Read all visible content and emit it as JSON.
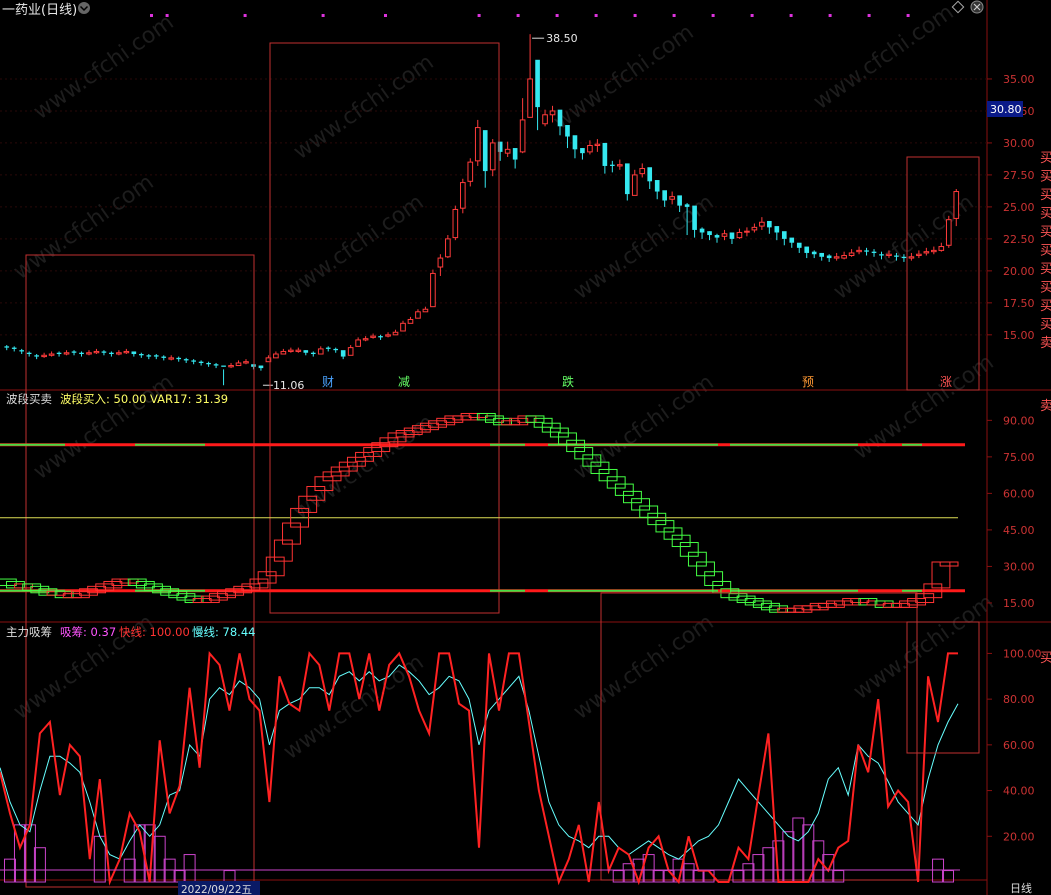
{
  "header": {
    "title": "一药业(日线)",
    "top_right_icons": [
      "diamond-icon",
      "close-icon"
    ],
    "chevron": "chevron-down-icon"
  },
  "price_panel": {
    "current_price_tag": "30.80",
    "high_label": "38.50",
    "low_label": "11.06",
    "signals": [
      {
        "text": "财",
        "color": "#4aa3ff"
      },
      {
        "text": "减",
        "color": "#66ff66"
      },
      {
        "text": "跌",
        "color": "#66ff66"
      },
      {
        "text": "预",
        "color": "#ff9933"
      },
      {
        "text": "涨",
        "color": "#ff5555"
      }
    ],
    "right_edge_labels": [
      "买",
      "买",
      "买",
      "买",
      "买",
      "买",
      "买",
      "买",
      "买",
      "买",
      "卖买"
    ]
  },
  "osc_panel": {
    "name": "波段买卖",
    "legend": [
      {
        "text": "波段买入: 50.00",
        "color": "#ffff66"
      },
      {
        "text": "VAR17: 31.39",
        "color": "#ffff66"
      }
    ],
    "right_edge_label": "卖"
  },
  "flow_panel": {
    "name": "主力吸筹",
    "legend": [
      {
        "text": "吸筹: 0.37",
        "color": "#ff55ff"
      },
      {
        "text": "快线: 100.00",
        "color": "#ff3333"
      },
      {
        "text": "慢线: 78.44",
        "color": "#66ffff"
      }
    ],
    "right_edge_label": "买"
  },
  "x_axis": {
    "labels": [
      "2022/09/22五"
    ],
    "corner_label": "日线"
  },
  "watermark": "www.cfchi.com",
  "chart_data": [
    {
      "type": "candlestick",
      "title": "一药业(日线)",
      "ylim": [
        11.0,
        40.0
      ],
      "yticks": [
        15.0,
        17.5,
        20.0,
        22.5,
        25.0,
        27.5,
        30.0,
        32.5,
        35.0
      ],
      "last_price": 30.8,
      "annotations": [
        {
          "text": "38.50",
          "value": 38.5
        },
        {
          "text": "11.06",
          "value": 11.06
        }
      ],
      "closes": [
        14.0,
        13.9,
        13.7,
        13.5,
        13.3,
        13.4,
        13.5,
        13.5,
        13.6,
        13.6,
        13.5,
        13.6,
        13.7,
        13.6,
        13.5,
        13.6,
        13.7,
        13.5,
        13.4,
        13.3,
        13.3,
        13.2,
        13.2,
        13.1,
        13.0,
        12.9,
        12.8,
        12.7,
        12.6,
        12.5,
        12.6,
        12.8,
        12.9,
        12.5,
        12.4,
        13.2,
        13.5,
        13.7,
        13.8,
        13.8,
        13.6,
        13.5,
        13.9,
        13.9,
        13.8,
        13.3,
        14.0,
        14.6,
        14.7,
        14.9,
        14.8,
        15.0,
        15.2,
        15.9,
        16.2,
        16.8,
        17.0,
        19.8,
        21.0,
        22.5,
        24.8,
        26.9,
        28.5,
        31.2,
        27.8,
        30.0,
        29.3,
        29.5,
        28.7,
        31.8,
        35.0,
        32.8,
        32.2,
        32.5,
        31.3,
        30.5,
        29.5,
        29.2,
        29.8,
        29.9,
        28.2,
        28.2,
        28.3,
        26.0,
        27.5,
        28.0,
        27.0,
        26.2,
        25.5,
        25.8,
        25.1,
        25.0,
        23.2,
        23.0,
        22.8,
        22.6,
        22.9,
        22.5,
        23.0,
        23.1,
        23.4,
        23.8,
        23.4,
        23.0,
        22.5,
        22.2,
        21.8,
        21.4,
        21.3,
        21.1,
        21.0,
        21.1,
        21.2,
        21.4,
        21.6,
        21.5,
        21.4,
        21.2,
        21.3,
        21.1,
        21.0,
        21.1,
        21.3,
        21.5,
        21.6,
        21.9,
        24.0,
        26.2
      ],
      "highs": [
        14.2,
        14.1,
        13.9,
        13.7,
        13.5,
        13.6,
        13.7,
        13.7,
        13.8,
        13.8,
        13.7,
        13.8,
        13.9,
        13.8,
        13.7,
        13.8,
        13.9,
        13.7,
        13.6,
        13.5,
        13.5,
        13.4,
        13.4,
        13.3,
        13.2,
        13.1,
        13.0,
        12.9,
        12.8,
        11.06,
        12.8,
        13.0,
        13.1,
        12.7,
        12.6,
        13.4,
        13.7,
        13.9,
        14.0,
        14.0,
        13.8,
        13.7,
        14.1,
        14.1,
        14.0,
        13.5,
        14.2,
        14.8,
        14.9,
        15.1,
        15.0,
        15.2,
        15.4,
        16.1,
        16.4,
        17.0,
        17.2,
        20.1,
        21.3,
        22.8,
        25.1,
        27.2,
        28.8,
        31.8,
        28.2,
        30.3,
        29.6,
        30.1,
        29.0,
        33.5,
        38.5,
        33.6,
        32.6,
        32.9,
        31.7,
        30.9,
        29.8,
        29.6,
        30.2,
        30.3,
        28.5,
        28.6,
        28.7,
        26.4,
        27.9,
        28.4,
        27.4,
        26.6,
        25.9,
        26.2,
        25.4,
        25.3,
        23.6,
        23.4,
        23.1,
        22.9,
        23.2,
        22.8,
        23.3,
        23.4,
        23.7,
        24.2,
        23.8,
        23.3,
        22.8,
        22.5,
        22.1,
        21.7,
        21.6,
        21.4,
        21.3,
        21.4,
        21.5,
        21.7,
        21.9,
        21.8,
        21.7,
        21.5,
        21.6,
        21.4,
        21.3,
        21.4,
        21.6,
        21.8,
        21.9,
        22.2,
        24.3,
        26.4
      ],
      "lows": [
        13.8,
        13.7,
        13.5,
        13.3,
        13.1,
        13.2,
        13.3,
        13.3,
        13.4,
        13.4,
        13.3,
        13.4,
        13.5,
        13.4,
        13.3,
        13.4,
        13.5,
        13.3,
        13.2,
        13.1,
        13.1,
        13.0,
        13.0,
        12.9,
        12.8,
        12.7,
        12.6,
        12.5,
        12.4,
        12.3,
        12.4,
        12.6,
        12.7,
        12.3,
        12.2,
        13.0,
        13.3,
        13.5,
        13.6,
        13.6,
        13.4,
        13.3,
        13.7,
        13.7,
        13.6,
        13.1,
        13.8,
        14.4,
        14.5,
        14.7,
        14.6,
        14.8,
        15.0,
        15.7,
        16.0,
        16.6,
        16.8,
        17.8,
        19.6,
        21.0,
        22.4,
        24.5,
        26.6,
        28.2,
        26.5,
        27.4,
        28.6,
        28.9,
        28.0,
        29.2,
        32.8,
        31.0,
        31.3,
        31.6,
        30.6,
        29.6,
        28.8,
        28.7,
        29.1,
        29.3,
        27.6,
        27.7,
        27.9,
        25.5,
        26.7,
        27.3,
        26.4,
        25.6,
        25.0,
        25.2,
        24.6,
        22.8,
        22.6,
        22.5,
        22.4,
        22.2,
        22.4,
        22.1,
        22.5,
        22.7,
        23.0,
        23.2,
        22.9,
        22.4,
        22.0,
        21.8,
        21.4,
        21.0,
        21.0,
        20.8,
        20.7,
        20.8,
        20.9,
        21.1,
        21.3,
        21.2,
        21.1,
        20.9,
        21.0,
        20.8,
        20.7,
        20.8,
        21.0,
        21.2,
        21.3,
        21.5,
        21.8,
        23.5
      ],
      "opens": [
        14.1,
        14.0,
        13.8,
        13.6,
        13.4,
        13.3,
        13.4,
        13.6,
        13.5,
        13.7,
        13.6,
        13.5,
        13.6,
        13.7,
        13.6,
        13.5,
        13.6,
        13.7,
        13.5,
        13.4,
        13.4,
        13.3,
        13.1,
        13.2,
        13.1,
        13.0,
        12.9,
        12.8,
        12.7,
        12.6,
        12.5,
        12.6,
        12.8,
        12.7,
        12.6,
        12.9,
        13.2,
        13.5,
        13.7,
        13.7,
        13.8,
        13.6,
        13.5,
        14.0,
        13.9,
        13.8,
        13.4,
        14.1,
        14.6,
        14.8,
        14.9,
        14.9,
        15.0,
        15.3,
        15.9,
        16.3,
        16.8,
        17.2,
        20.3,
        21.1,
        22.6,
        24.9,
        27.0,
        28.6,
        31.0,
        27.9,
        30.1,
        29.2,
        29.6,
        29.3,
        32.0,
        36.5,
        31.5,
        32.2,
        32.6,
        31.4,
        30.6,
        29.6,
        29.3,
        29.8,
        30.0,
        28.3,
        28.2,
        28.4,
        25.9,
        27.6,
        28.1,
        27.1,
        26.3,
        25.6,
        25.9,
        25.2,
        25.1,
        23.3,
        23.1,
        22.8,
        22.7,
        23.0,
        22.6,
        23.1,
        23.2,
        23.5,
        23.9,
        23.5,
        23.1,
        22.6,
        22.2,
        21.9,
        21.5,
        21.4,
        21.2,
        21.0,
        21.0,
        21.2,
        21.5,
        21.6,
        21.5,
        21.3,
        21.2,
        21.2,
        21.1,
        21.0,
        21.2,
        21.4,
        21.5,
        21.6,
        22.0,
        24.1
      ],
      "series": [
        {
          "values": [
            14.0,
            13.9,
            13.7,
            13.5,
            13.3,
            13.4,
            13.5,
            13.5,
            13.6,
            13.6,
            13.5,
            13.6,
            13.7,
            13.6,
            13.5,
            13.6,
            13.7,
            13.5,
            13.4,
            13.3,
            13.3,
            13.2,
            13.2,
            13.1,
            13.0,
            12.9,
            12.8,
            12.7,
            12.6,
            12.5,
            12.6,
            12.8,
            12.9,
            12.5,
            12.4,
            13.2,
            13.5,
            13.7,
            13.8,
            13.8,
            13.6,
            13.5,
            13.9,
            13.9,
            13.8,
            13.3,
            14.0,
            14.6,
            14.7,
            14.9,
            14.8,
            15.0,
            15.2,
            15.9,
            16.2,
            16.8,
            17.0,
            19.8,
            21.0,
            22.5,
            24.8,
            26.9,
            28.5,
            31.2,
            27.8,
            30.0,
            29.3,
            29.5,
            28.7,
            31.8,
            35.0,
            32.8,
            32.2,
            32.5,
            31.3,
            30.5,
            29.5,
            29.2,
            29.8,
            29.9,
            28.2,
            28.2,
            28.3,
            26.0,
            27.5,
            28.0,
            27.0,
            26.2,
            25.5,
            25.8,
            25.1,
            25.0,
            23.2,
            23.0,
            22.8,
            22.6,
            22.9,
            22.5,
            23.0,
            23.1,
            23.4,
            23.8,
            23.4,
            23.0,
            22.5,
            22.2,
            21.8,
            21.4,
            21.3,
            21.1,
            21.0,
            21.1,
            21.2,
            21.4,
            21.6,
            21.5,
            21.4,
            21.2,
            21.3,
            21.1,
            21.0,
            21.1,
            21.3,
            21.5,
            21.6,
            21.9,
            24.0,
            26.2
          ]
        }
      ]
    },
    {
      "type": "line",
      "title": "波段买卖",
      "ylim": [
        8,
        100
      ],
      "yticks": [
        15.0,
        30.0,
        45.0,
        60.0,
        75.0,
        90.0
      ],
      "hlines": [
        80,
        50,
        20
      ],
      "series": [
        {
          "name": "VAR17",
          "values": [
            24,
            23,
            22,
            22,
            21,
            20,
            19,
            19,
            18,
            18,
            19,
            20,
            21,
            22,
            23,
            24,
            24,
            23,
            22,
            21,
            20,
            19,
            18,
            17,
            16,
            16,
            17,
            18,
            19,
            20,
            21,
            22,
            24,
            27,
            33,
            40,
            47,
            53,
            58,
            62,
            66,
            68,
            70,
            72,
            74,
            76,
            78,
            80,
            82,
            84,
            85,
            86,
            87,
            88,
            89,
            90,
            91,
            91,
            92,
            92,
            91,
            90,
            89,
            89,
            90,
            91,
            90,
            88,
            86,
            84,
            81,
            78,
            75,
            72,
            69,
            66,
            63,
            60,
            57,
            54,
            51,
            48,
            45,
            42,
            39,
            35,
            31,
            27,
            23,
            20,
            18,
            17,
            16,
            15,
            14,
            13,
            12,
            12,
            12,
            13,
            13,
            14,
            14,
            15,
            15,
            16,
            16,
            15,
            15,
            14,
            14,
            14,
            15,
            16,
            18,
            22,
            31,
            31
          ]
        }
      ]
    },
    {
      "type": "line",
      "title": "主力吸筹",
      "ylim": [
        0,
        105
      ],
      "yticks": [
        20.0,
        40.0,
        60.0,
        80.0,
        100.0
      ],
      "series": [
        {
          "name": "快线",
          "values": [
            48,
            30,
            15,
            25,
            65,
            70,
            38,
            60,
            55,
            10,
            45,
            0,
            10,
            30,
            22,
            0,
            62,
            30,
            42,
            85,
            50,
            100,
            95,
            75,
            100,
            80,
            75,
            35,
            90,
            78,
            75,
            100,
            95,
            75,
            100,
            100,
            80,
            100,
            75,
            95,
            100,
            90,
            75,
            65,
            100,
            100,
            78,
            75,
            15,
            100,
            75,
            100,
            100,
            70,
            40,
            20,
            0,
            10,
            25,
            0,
            35,
            5,
            15,
            12,
            0,
            15,
            20,
            5,
            0,
            20,
            5,
            5,
            0,
            0,
            15,
            10,
            38,
            65,
            0,
            0,
            0,
            0,
            10,
            5,
            15,
            18,
            60,
            48,
            80,
            33,
            40,
            35,
            0,
            90,
            70,
            100,
            100
          ]
        },
        {
          "name": "慢线",
          "values": [
            50,
            35,
            25,
            22,
            40,
            55,
            55,
            52,
            48,
            35,
            20,
            12,
            10,
            18,
            25,
            20,
            25,
            38,
            40,
            60,
            55,
            80,
            85,
            82,
            88,
            85,
            80,
            60,
            75,
            78,
            80,
            85,
            85,
            82,
            90,
            92,
            88,
            92,
            88,
            90,
            95,
            92,
            88,
            82,
            85,
            90,
            88,
            80,
            60,
            75,
            80,
            85,
            90,
            75,
            55,
            35,
            25,
            20,
            18,
            15,
            20,
            20,
            15,
            12,
            15,
            18,
            15,
            12,
            10,
            14,
            18,
            20,
            25,
            35,
            45,
            40,
            35,
            30,
            25,
            20,
            18,
            22,
            30,
            45,
            50,
            38,
            60,
            55,
            52,
            44,
            35,
            30,
            25,
            45,
            60,
            70,
            78
          ]
        },
        {
          "name": "吸筹",
          "values": [
            0,
            10,
            25,
            25,
            15,
            0,
            0,
            0,
            0,
            0,
            20,
            0,
            0,
            10,
            25,
            25,
            20,
            10,
            5,
            12,
            0,
            0,
            0,
            5,
            0,
            0,
            0,
            0,
            0,
            0,
            0,
            0,
            0,
            0,
            0,
            0,
            0,
            0,
            0,
            0,
            0,
            0,
            0,
            0,
            0,
            0,
            0,
            0,
            0,
            0,
            0,
            0,
            0,
            0,
            0,
            0,
            0,
            0,
            0,
            0,
            0,
            0,
            5,
            8,
            10,
            12,
            5,
            5,
            10,
            8,
            5,
            5,
            0,
            0,
            5,
            8,
            12,
            15,
            18,
            22,
            28,
            25,
            18,
            12,
            5,
            0,
            0,
            0,
            0,
            0,
            0,
            0,
            0,
            0,
            10,
            5,
            0,
            0,
            0
          ]
        }
      ]
    }
  ]
}
